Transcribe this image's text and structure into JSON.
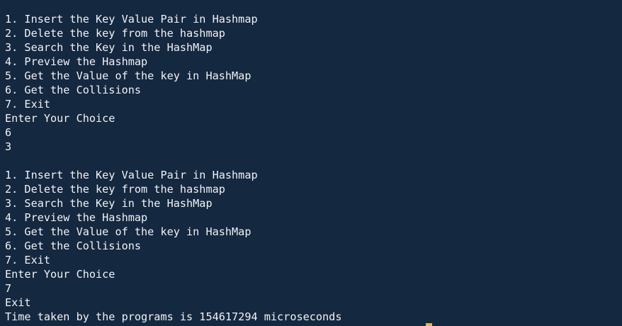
{
  "terminal": {
    "lines": [
      "1. Insert the Key Value Pair in Hashmap",
      "2. Delete the key from the hashmap",
      "3. Search the Key in the HashMap",
      "4. Preview the Hashmap",
      "5. Get the Value of the key in HashMap",
      "6. Get the Collisions",
      "7. Exit",
      "Enter Your Choice",
      "6",
      "3",
      "",
      "1. Insert the Key Value Pair in Hashmap",
      "2. Delete the key from the hashmap",
      "3. Search the Key in the HashMap",
      "4. Preview the Hashmap",
      "5. Get the Value of the key in HashMap",
      "6. Get the Collisions",
      "7. Exit",
      "Enter Your Choice",
      "7",
      "Exit",
      "Time taken by the programs is 154617294 microseconds"
    ],
    "cursor_color": "#e8b53a",
    "background_color": "#142840",
    "text_color": "#f2f2f2"
  }
}
